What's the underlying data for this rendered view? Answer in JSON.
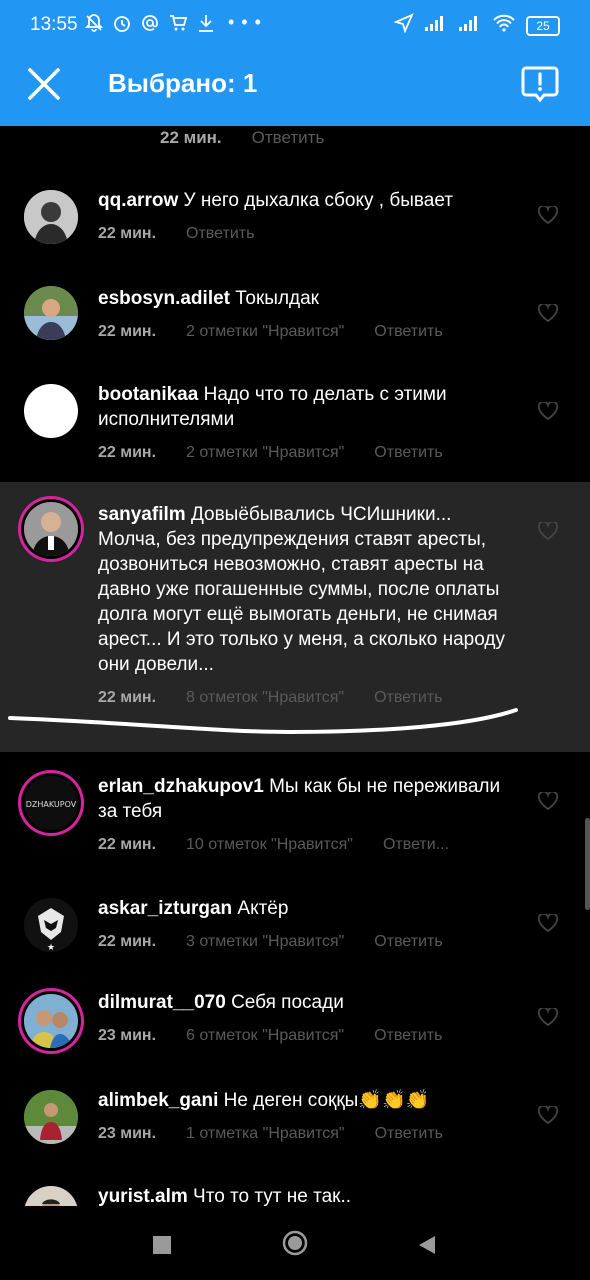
{
  "status_bar": {
    "time": "13:55",
    "battery": "25",
    "left_icons": [
      "muted-bell-icon",
      "alarm-icon",
      "at-icon",
      "cart-icon",
      "download-icon"
    ],
    "more_dots": "• • •"
  },
  "header": {
    "title": "Выбрано: 1",
    "accent": "#2196f3"
  },
  "top_meta": {
    "time": "22 мин.",
    "reply": "Ответить"
  },
  "comments": [
    {
      "user": "qq.arrow",
      "text": "У него дыхалка сбоку , бывает",
      "time": "22 мин.",
      "likes": "",
      "reply": "Ответить"
    },
    {
      "user": "esbosyn.adilet",
      "text": "Токылдак",
      "time": "22 мин.",
      "likes": "2 отметки \"Нравится\"",
      "reply": "Ответить"
    },
    {
      "user": "bootanikaa",
      "text": "Надо что то делать с этими исполнителями",
      "time": "22 мин.",
      "likes": "2 отметки \"Нравится\"",
      "reply": "Ответить"
    },
    {
      "user": "sanyafilm",
      "text": "Довыёбывались ЧСИшники... Молча, без предупреждения ставят аресты, дозвониться невозможно, ставят аресты на давно уже погашенные суммы, после оплаты долга могут ещё вымогать деньги, не снимая арест... И это только у меня, а сколько народу они довели...",
      "time": "22 мин.",
      "likes": "8 отметок \"Нравится\"",
      "reply": "Ответить"
    },
    {
      "user": "erlan_dzhakupov1",
      "text": "Мы как бы не переживали за тебя",
      "time": "22 мин.",
      "likes": "10 отметок \"Нравится\"",
      "reply": "Ответи..."
    },
    {
      "user": "askar_izturgan",
      "text": "Актёр",
      "time": "22 мин.",
      "likes": "3 отметки \"Нравится\"",
      "reply": "Ответить"
    },
    {
      "user": "dilmurat__070",
      "text": "Себя посади",
      "time": "23 мин.",
      "likes": "6 отметок \"Нравится\"",
      "reply": "Ответить"
    },
    {
      "user": "alimbek_gani",
      "text": "Не деген соққы👏👏👏",
      "time": "23 мин.",
      "likes": "1 отметка \"Нравится\"",
      "reply": "Ответить"
    },
    {
      "user": "yurist.alm",
      "text": "Что то тут не так..",
      "time": "",
      "likes": "",
      "reply": ""
    }
  ],
  "avatar_labels": {
    "erlan": "DZHAKUPOV"
  }
}
